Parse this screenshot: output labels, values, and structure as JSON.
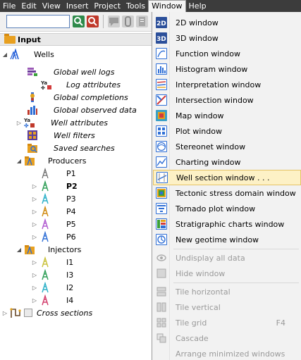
{
  "menubar": {
    "items": [
      "File",
      "Edit",
      "View",
      "Insert",
      "Project",
      "Tools",
      "Window",
      "Help"
    ],
    "active": "Window"
  },
  "toolbar": {
    "search_value": ""
  },
  "panel": {
    "title": "Input"
  },
  "tree": [
    {
      "label": "Wells",
      "icon": "wells-icon",
      "italic": false,
      "bold": false
    },
    {
      "label": "Global well logs",
      "icon": "well-logs-icon",
      "italic": true,
      "bold": false
    },
    {
      "label": "Log attributes",
      "icon": "log-attributes-icon",
      "italic": true,
      "bold": false
    },
    {
      "label": "Global completions",
      "icon": "completions-icon",
      "italic": true,
      "bold": false
    },
    {
      "label": "Global observed data",
      "icon": "observed-data-icon",
      "italic": true,
      "bold": false
    },
    {
      "label": "Well attributes",
      "icon": "well-attributes-icon",
      "italic": true,
      "bold": false
    },
    {
      "label": "Well filters",
      "icon": "well-filters-icon",
      "italic": true,
      "bold": false
    },
    {
      "label": "Saved searches",
      "icon": "saved-searches-icon",
      "italic": true,
      "bold": false
    },
    {
      "label": "Producers",
      "icon": "folder-icon",
      "italic": false,
      "bold": false
    },
    {
      "label": "P1",
      "icon": "well-icon",
      "italic": false,
      "bold": false
    },
    {
      "label": "P2",
      "icon": "well-icon",
      "italic": false,
      "bold": true
    },
    {
      "label": "P3",
      "icon": "well-icon",
      "italic": false,
      "bold": false
    },
    {
      "label": "P4",
      "icon": "well-icon",
      "italic": false,
      "bold": false
    },
    {
      "label": "P5",
      "icon": "well-icon",
      "italic": false,
      "bold": false
    },
    {
      "label": "P6",
      "icon": "well-icon",
      "italic": false,
      "bold": false
    },
    {
      "label": "Injectors",
      "icon": "folder-icon",
      "italic": false,
      "bold": false
    },
    {
      "label": "I1",
      "icon": "well-icon",
      "italic": false,
      "bold": false
    },
    {
      "label": "I3",
      "icon": "well-icon",
      "italic": false,
      "bold": false
    },
    {
      "label": "I2",
      "icon": "well-icon",
      "italic": false,
      "bold": false
    },
    {
      "label": "I4",
      "icon": "well-icon",
      "italic": false,
      "bold": false
    },
    {
      "label": "Cross sections",
      "icon": "cross-sections-icon",
      "italic": true,
      "bold": false
    }
  ],
  "window_menu": [
    {
      "label": "2D window",
      "icon": "2d-window-icon",
      "enabled": true
    },
    {
      "label": "3D window",
      "icon": "3d-window-icon",
      "enabled": true
    },
    {
      "label": "Function window",
      "icon": "function-window-icon",
      "enabled": true
    },
    {
      "label": "Histogram window",
      "icon": "histogram-window-icon",
      "enabled": true
    },
    {
      "label": "Interpretation window",
      "icon": "interpretation-window-icon",
      "enabled": true
    },
    {
      "label": "Intersection window",
      "icon": "intersection-window-icon",
      "enabled": true
    },
    {
      "label": "Map window",
      "icon": "map-window-icon",
      "enabled": true
    },
    {
      "label": "Plot window",
      "icon": "plot-window-icon",
      "enabled": true
    },
    {
      "label": "Stereonet window",
      "icon": "stereonet-window-icon",
      "enabled": true
    },
    {
      "label": "Charting window",
      "icon": "charting-window-icon",
      "enabled": true
    },
    {
      "label": "Well section window . . .",
      "icon": "well-section-window-icon",
      "enabled": true,
      "highlighted": true
    },
    {
      "label": "Tectonic stress domain window",
      "icon": "tectonic-stress-window-icon",
      "enabled": true
    },
    {
      "label": "Tornado plot window",
      "icon": "tornado-plot-window-icon",
      "enabled": true
    },
    {
      "label": "Stratigraphic charts window",
      "icon": "stratigraphic-charts-window-icon",
      "enabled": true
    },
    {
      "label": "New geotime window",
      "icon": "geotime-window-icon",
      "enabled": true
    },
    {
      "label": "Undisplay all data",
      "icon": "undisplay-icon",
      "enabled": false
    },
    {
      "label": "Hide window",
      "icon": "hide-window-icon",
      "enabled": false
    },
    {
      "label": "Tile horizontal",
      "icon": "tile-horizontal-icon",
      "enabled": false
    },
    {
      "label": "Tile vertical",
      "icon": "tile-vertical-icon",
      "enabled": false
    },
    {
      "label": "Tile grid",
      "icon": "tile-grid-icon",
      "enabled": false,
      "shortcut": "F4"
    },
    {
      "label": "Cascade",
      "icon": "cascade-icon",
      "enabled": false
    },
    {
      "label": "Arrange minimized windows",
      "icon": "",
      "enabled": false
    }
  ]
}
